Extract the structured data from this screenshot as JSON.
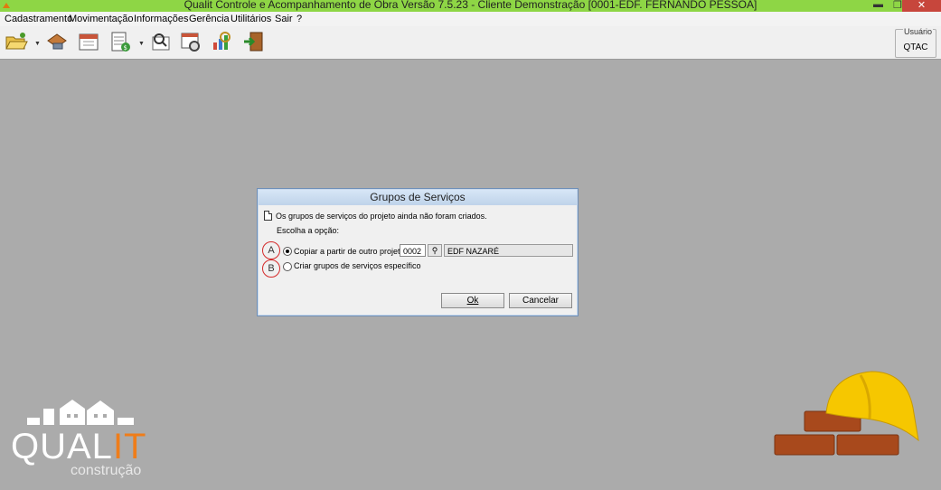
{
  "window": {
    "title": "Qualit Controle e Acompanhamento de Obra Versão 7.5.23 - Cliente Demonstração [0001-EDF. FERNANDO PESSOA]",
    "minimize_glyph": "▬",
    "restore_glyph": "❐",
    "close_glyph": "✕"
  },
  "menu": [
    "Cadastramento",
    "Movimentação",
    "Informações",
    "Gerência",
    "Utilitários",
    "Sair",
    "?"
  ],
  "toolbar": {
    "icons": [
      "folder-open-icon",
      "toolbox-icon",
      "calendar-icon",
      "spreadsheet-money-icon",
      "user-search-icon",
      "calendar-clock-icon",
      "chart-magnify-icon",
      "exit-door-icon"
    ],
    "user_legend": "Usuário",
    "user_value": "QTAC"
  },
  "dialog": {
    "title": "Grupos de Serviços",
    "message": "Os grupos de serviços do projeto ainda não foram criados.",
    "choose_label": "Escolha a opção:",
    "option_a_marker": "A",
    "option_b_marker": "B",
    "option_a_label": "Copiar a partir de outro projeto",
    "option_b_label": "Criar grupos de serviços específico",
    "selected_option": "A",
    "project_code": "0002",
    "project_name": "EDF NAZARÉ",
    "ok_label": "Ok",
    "cancel_label": "Cancelar"
  },
  "branding": {
    "logo_main": "QUAL",
    "logo_accent": "IT",
    "logo_sub": "construção"
  },
  "colors": {
    "titlebar": "#8ed645",
    "desktop": "#ababab",
    "logo_accent": "#ef7d1a",
    "helmet": "#f6c700",
    "brick": "#a8491c"
  }
}
